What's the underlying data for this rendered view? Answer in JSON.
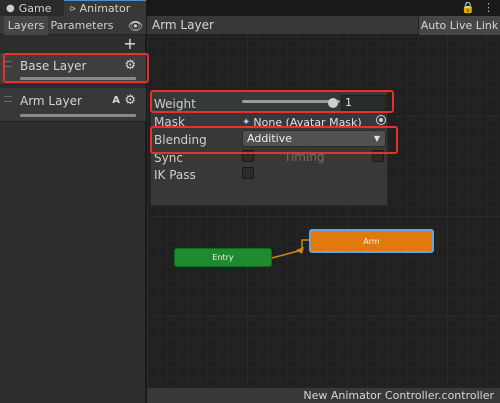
{
  "tabs": [
    {
      "label": "Game",
      "icon": "gamepad-icon"
    },
    {
      "label": "Animator",
      "icon": "animator-icon"
    }
  ],
  "left_panel": {
    "subtabs": [
      "Layers",
      "Parameters"
    ],
    "layers": [
      {
        "name": "Base Layer"
      },
      {
        "name": "Arm Layer",
        "badge": "A"
      }
    ]
  },
  "graph": {
    "breadcrumb": "Arm Layer",
    "auto_live_link": "Auto Live Link",
    "footer": "New Animator Controller.controller"
  },
  "layer_settings": {
    "weight_label": "Weight",
    "weight_value": "1",
    "mask_label": "Mask",
    "mask_value": "None (Avatar Mask)",
    "blending_label": "Blending",
    "blending_value": "Additive",
    "sync_label": "Sync",
    "timing_label": "Timing",
    "ik_pass_label": "IK Pass"
  },
  "states": {
    "entry": "Entry",
    "arm": "Arm"
  },
  "colors": {
    "entry_node": "#1f8a2e",
    "arm_node": "#e07a0c",
    "highlight": "#e6322b",
    "transition": "#c98a12"
  }
}
